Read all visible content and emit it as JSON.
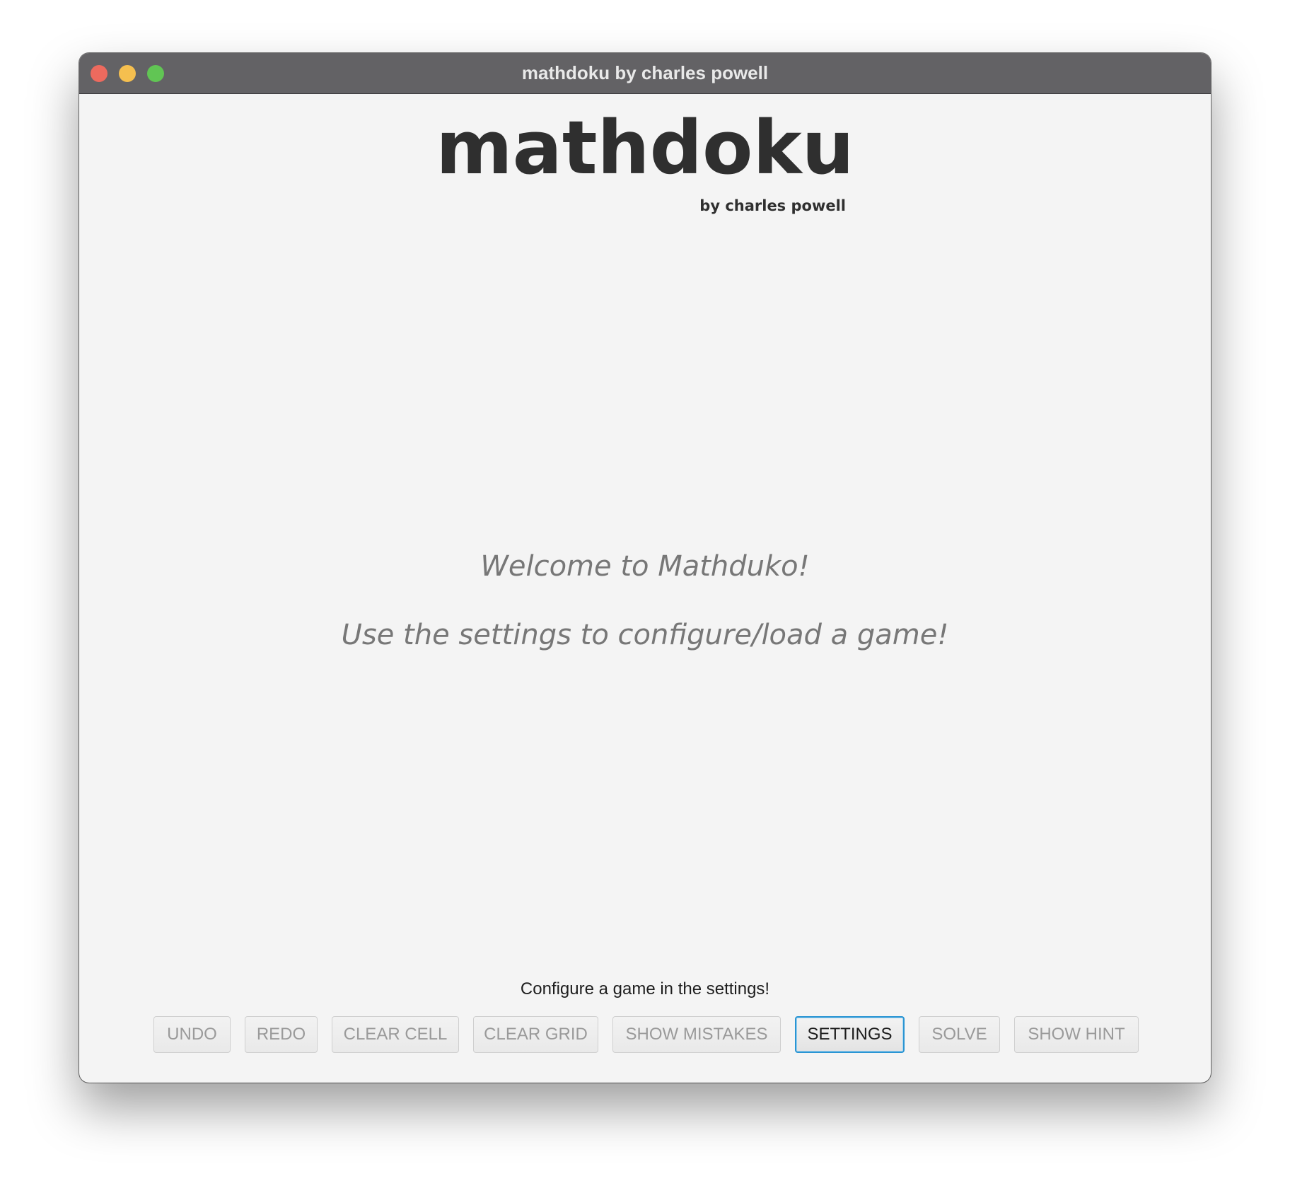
{
  "window": {
    "title": "mathdoku by charles powell"
  },
  "header": {
    "title": "mathdoku",
    "byline": "by charles powell"
  },
  "main": {
    "welcome_line1": "Welcome to Mathduko!",
    "welcome_line2": "Use the settings to configure/load a game!"
  },
  "status": {
    "message": "Configure a game in the settings!"
  },
  "toolbar": {
    "undo": "UNDO",
    "redo": "REDO",
    "clear_cell": "CLEAR CELL",
    "clear_grid": "CLEAR GRID",
    "show_mistakes": "SHOW MISTAKES",
    "settings": "SETTINGS",
    "solve": "SOLVE",
    "show_hint": "SHOW HINT"
  },
  "colors": {
    "titlebar": "#636265",
    "close": "#ed6a5e",
    "minimize": "#f5bf4f",
    "zoom": "#61c554",
    "focus_ring": "#2a95d3",
    "disabled_text": "#9a9a9a"
  }
}
